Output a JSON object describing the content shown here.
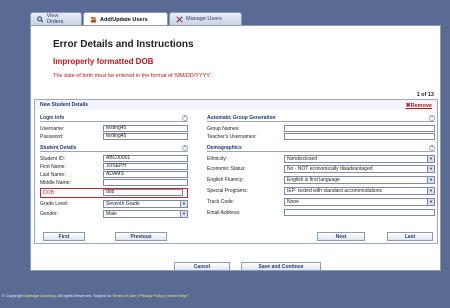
{
  "tabs": [
    {
      "label": "View Orders",
      "icon": "search-icon"
    },
    {
      "label": "Add/Update Users",
      "icon": "users-icon"
    },
    {
      "label": "Manage Users",
      "icon": "tools-icon"
    }
  ],
  "page": {
    "title": "Error Details and Instructions",
    "error_title": "Improperly formatted DOB",
    "error_message": "The date of birth must be entered in the format of 'MM/DD/YYYY'.",
    "page_count": "1 of 13"
  },
  "form": {
    "header": "New Student Details",
    "remove": "Remove",
    "login": {
      "title": "Login Info",
      "username_label": "Username:",
      "username": "testing45",
      "password_label": "Password:",
      "password": "testing45"
    },
    "auto_group": {
      "title": "Automatic Group Generation",
      "group_names_label": "Group Names:",
      "group_names": "",
      "teacher_usernames_label": "Teacher's Usernames:",
      "teacher_usernames": ""
    },
    "student": {
      "title": "Student Details",
      "id_label": "Student ID:",
      "id": "ABC00001",
      "first_label": "First Name:",
      "first": "JOSEPH",
      "last_label": "Last Name:",
      "last": "ADAMS",
      "middle_label": "Middle Name:",
      "middle": "",
      "dob_label": "DOB:",
      "dob": "dob",
      "grade_label": "Grade Level:",
      "grade": "Seventh Grade",
      "gender_label": "Gender:",
      "gender": "Male"
    },
    "demographics": {
      "title": "Demographics",
      "ethnicity_label": "Ethnicity:",
      "ethnicity": "Nondisclosed",
      "economic_label": "Economic Status:",
      "economic": "No - NOT economically disadvantaged",
      "english_label": "English Fluency:",
      "english": "English is first language",
      "special_label": "Special Programs:",
      "special": "IEP- tested with standard accommodations",
      "track_label": "Track Code:",
      "track": "None",
      "email_label": "Email Address:",
      "email": ""
    },
    "nav": {
      "first": "First",
      "previous": "Previous",
      "next": "Next",
      "last": "Last"
    }
  },
  "actions": {
    "cancel": "Cancel",
    "save": "Save and Continue"
  },
  "footer": {
    "prefix": "© Copyright",
    "company": "Vantage Learning",
    "rights": ". All rights Reserved. Subject to",
    "terms": "Terms of Use",
    "privacy": "Privacy Policy",
    "help": "Need Help?"
  }
}
